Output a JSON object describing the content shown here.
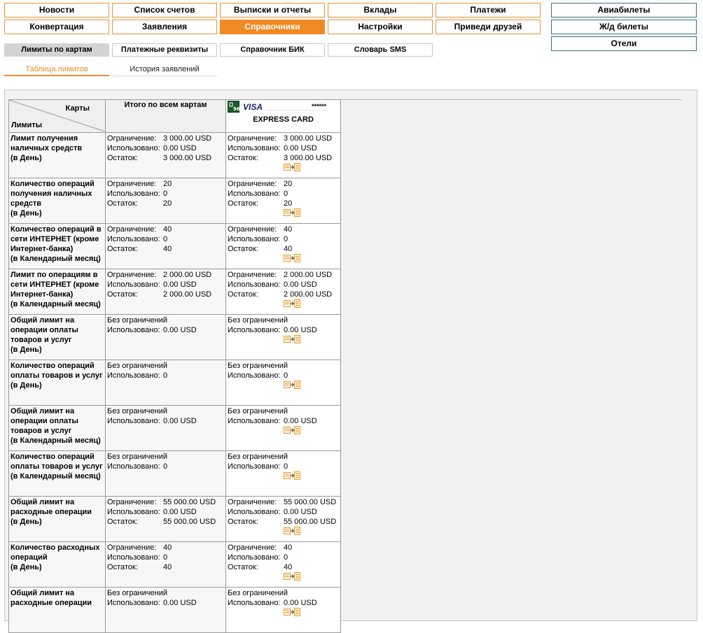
{
  "nav": {
    "row1": [
      "Новости",
      "Список счетов",
      "Выписки и отчеты",
      "Вклады",
      "Платежи"
    ],
    "row2": [
      "Конвертация",
      "Заявления",
      "Справочники",
      "Настройки",
      "Приведи друзей"
    ],
    "active": "Справочники",
    "travel": [
      "Авиабилеты",
      "Ж/д билеты",
      "Отели"
    ]
  },
  "subnav": {
    "items": [
      "Лимиты по картам",
      "Платежные реквизиты",
      "Справочник БИК",
      "Словарь SMS"
    ],
    "active": "Лимиты по картам"
  },
  "tabs": {
    "items": [
      "Таблица лимитов",
      "История заявлений"
    ],
    "active": "Таблица лимитов"
  },
  "table": {
    "header": {
      "cards_label": "Карты",
      "limits_label": "Лимиты",
      "total_label": "Итого по всем картам",
      "card_brand": "VISA",
      "card_mask": "******",
      "card_name": "EXPRESS CARD"
    },
    "labels": {
      "limit": "Ограничение:",
      "used": "Использовано:",
      "rest": "Остаток:",
      "unlimited": "Без ограничений"
    },
    "rows": [
      {
        "name": [
          "Лимит получения",
          "наличных средств",
          "(в День)"
        ],
        "total": {
          "limit": "3 000.00 USD",
          "used": "0.00 USD",
          "rest": "3 000.00 USD"
        },
        "card": {
          "limit": "3 000.00 USD",
          "used": "0.00 USD",
          "rest": "3 000.00 USD"
        }
      },
      {
        "name": [
          "Количество операций",
          "получения наличных",
          "средств",
          "(в День)"
        ],
        "total": {
          "limit": "20",
          "used": "0",
          "rest": "20"
        },
        "card": {
          "limit": "20",
          "used": "0",
          "rest": "20"
        }
      },
      {
        "name": [
          "Количество операций в",
          "сети ИНТЕРНЕТ (кроме",
          "Интернет-банка)",
          "(в Календарный месяц)"
        ],
        "total": {
          "limit": "40",
          "used": "0",
          "rest": "40"
        },
        "card": {
          "limit": "40",
          "used": "0",
          "rest": "40"
        }
      },
      {
        "name": [
          "Лимит по операциям в",
          "сети ИНТЕРНЕТ (кроме",
          "Интернет-банка)",
          "(в Календарный месяц)"
        ],
        "total": {
          "limit": "2 000.00 USD",
          "used": "0.00 USD",
          "rest": "2 000.00 USD"
        },
        "card": {
          "limit": "2 000.00 USD",
          "used": "0.00 USD",
          "rest": "2 000.00 USD"
        }
      },
      {
        "name": [
          "Общий лимит на",
          "операции оплаты",
          "товаров и услуг",
          "(в День)"
        ],
        "total": {
          "unlimited": true,
          "used": "0.00 USD"
        },
        "card": {
          "unlimited": true,
          "used": "0.00 USD"
        }
      },
      {
        "name": [
          "Количество операций",
          "оплаты товаров и услуг",
          "(в День)"
        ],
        "total": {
          "unlimited": true,
          "used": "0"
        },
        "card": {
          "unlimited": true,
          "used": "0"
        }
      },
      {
        "name": [
          "Общий лимит на",
          "операции оплаты",
          "товаров и услуг",
          "(в Календарный месяц)"
        ],
        "total": {
          "unlimited": true,
          "used": "0.00 USD"
        },
        "card": {
          "unlimited": true,
          "used": "0.00 USD"
        }
      },
      {
        "name": [
          "Количество операций",
          "оплаты товаров и услуг",
          "(в Календарный месяц)"
        ],
        "total": {
          "unlimited": true,
          "used": "0"
        },
        "card": {
          "unlimited": true,
          "used": "0"
        }
      },
      {
        "name": [
          "Общий лимит на",
          "расходные операции",
          "(в День)"
        ],
        "total": {
          "limit": "55 000.00 USD",
          "used": "0.00 USD",
          "rest": "55 000.00 USD"
        },
        "card": {
          "limit": "55 000.00 USD",
          "used": "0.00 USD",
          "rest": "55 000.00 USD"
        }
      },
      {
        "name": [
          "Количество расходных",
          "операций",
          "(в День)"
        ],
        "total": {
          "limit": "40",
          "used": "0",
          "rest": "40"
        },
        "card": {
          "limit": "40",
          "used": "0",
          "rest": "40"
        }
      },
      {
        "name": [
          "Общий лимит на",
          "расходные операции"
        ],
        "total": {
          "unlimited": true,
          "used": "0.00 USD"
        },
        "card": {
          "unlimited": true,
          "used": "0.00 USD"
        }
      }
    ]
  }
}
